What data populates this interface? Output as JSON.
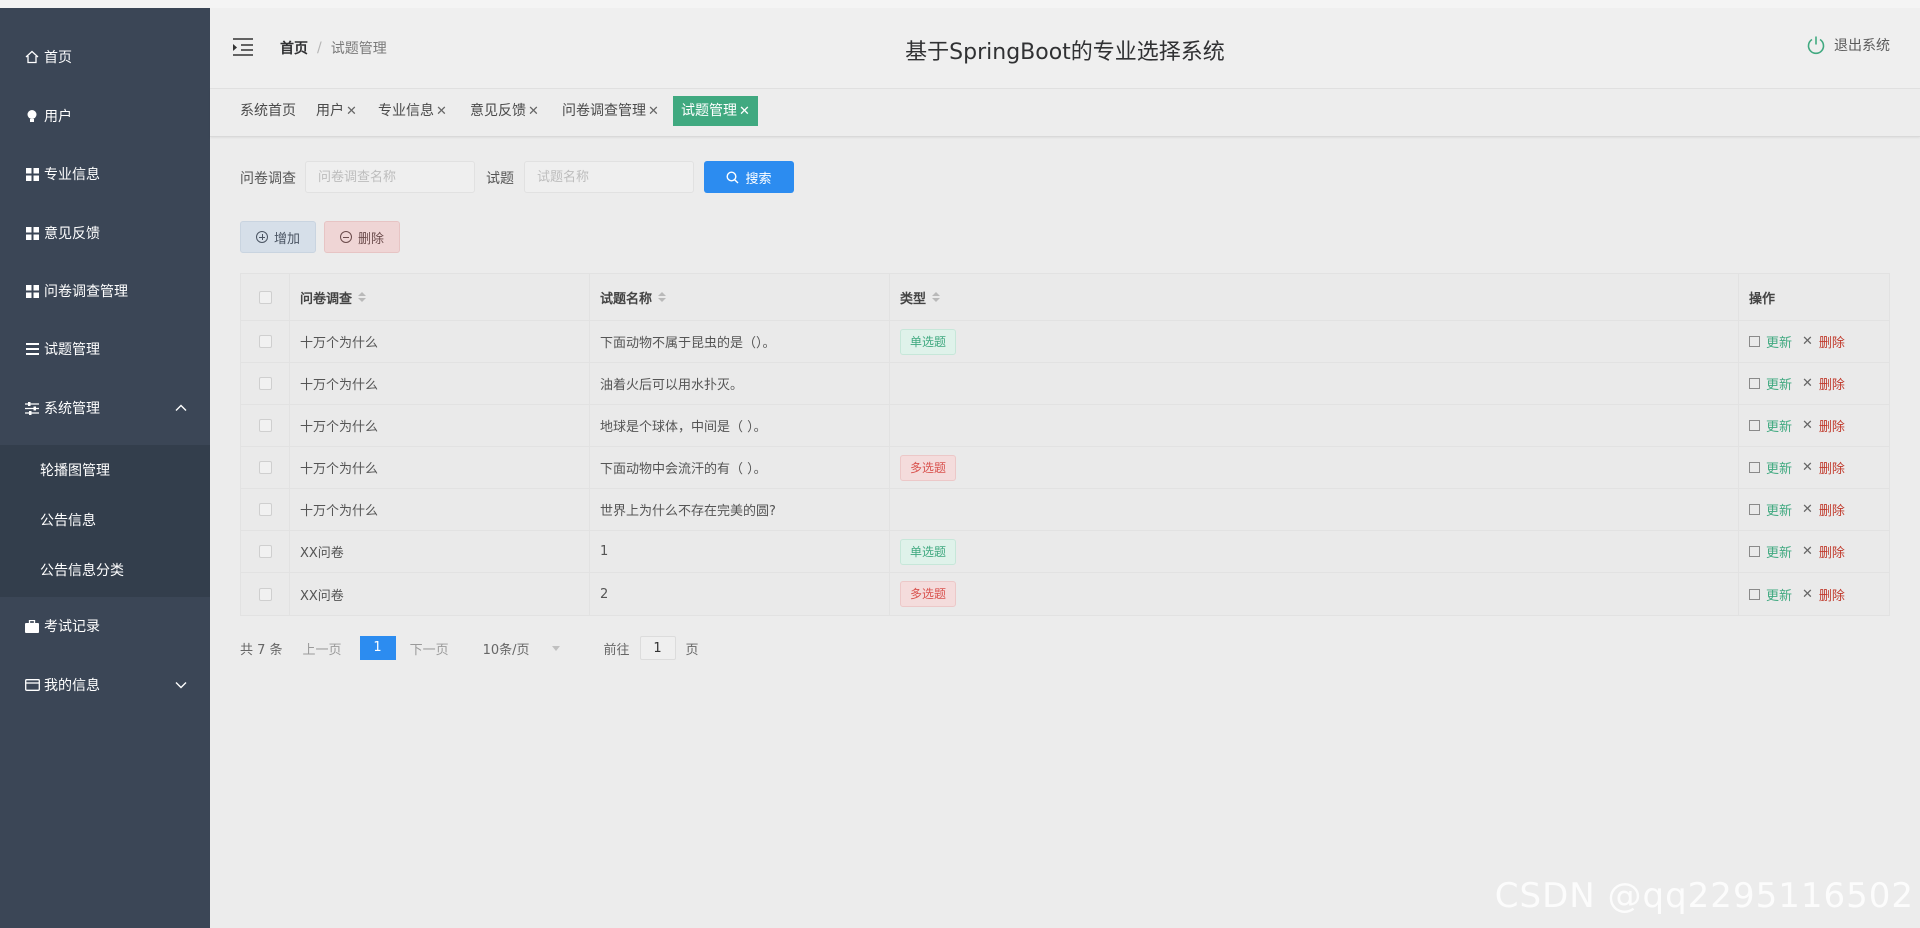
{
  "app_title": "基于SpringBoot的专业选择系统",
  "sidebar": {
    "items": [
      {
        "label": "首页",
        "icon": "home-icon"
      },
      {
        "label": "用户",
        "icon": "bulb-icon"
      },
      {
        "label": "专业信息",
        "icon": "grid-icon"
      },
      {
        "label": "意见反馈",
        "icon": "grid-icon"
      },
      {
        "label": "问卷调查管理",
        "icon": "grid-icon"
      },
      {
        "label": "试题管理",
        "icon": "list-icon"
      },
      {
        "label": "系统管理",
        "icon": "sliders-icon",
        "expanded": true
      },
      {
        "label": "考试记录",
        "icon": "briefcase-icon"
      },
      {
        "label": "我的信息",
        "icon": "card-icon",
        "expanded": false
      }
    ],
    "submenu": [
      "轮播图管理",
      "公告信息",
      "公告信息分类"
    ]
  },
  "header": {
    "breadcrumb_home": "首页",
    "breadcrumb_sep": "/",
    "breadcrumb_current": "试题管理",
    "logout": "退出系统"
  },
  "tabs": [
    {
      "label": "系统首页",
      "closable": false,
      "active": false
    },
    {
      "label": "用户",
      "closable": true,
      "active": false
    },
    {
      "label": "专业信息",
      "closable": true,
      "active": false
    },
    {
      "label": "意见反馈",
      "closable": true,
      "active": false
    },
    {
      "label": "问卷调查管理",
      "closable": true,
      "active": false
    },
    {
      "label": "试题管理",
      "closable": true,
      "active": true
    }
  ],
  "search": {
    "survey_label": "问卷调查",
    "survey_placeholder": "问卷调查名称",
    "question_label": "试题",
    "question_placeholder": "试题名称",
    "button": "搜索"
  },
  "actions": {
    "add": "增加",
    "delete": "删除"
  },
  "table": {
    "columns": [
      "问卷调查",
      "试题名称",
      "类型",
      "操作"
    ],
    "rows": [
      {
        "survey": "十万个为什么",
        "name": "下面动物不属于昆虫的是（）。",
        "type": "单选题"
      },
      {
        "survey": "十万个为什么",
        "name": "油着火后可以用水扑灭。",
        "type": ""
      },
      {
        "survey": "十万个为什么",
        "name": "地球是个球体，中间是（ ）。",
        "type": ""
      },
      {
        "survey": "十万个为什么",
        "name": "下面动物中会流汗的有（ ）。",
        "type": "多选题"
      },
      {
        "survey": "十万个为什么",
        "name": "世界上为什么不存在完美的圆?",
        "type": ""
      },
      {
        "survey": "XX问卷",
        "name": "1",
        "type": "单选题"
      },
      {
        "survey": "XX问卷",
        "name": "2",
        "type": "多选题"
      }
    ],
    "op_edit": "更新",
    "op_delete": "删除"
  },
  "pagination": {
    "total": "共 7 条",
    "prev": "上一页",
    "current": "1",
    "next": "下一页",
    "page_size": "10条/页",
    "goto_prefix": "前往",
    "goto_value": "1",
    "goto_suffix": "页"
  },
  "watermark": "CSDN @qq2295116502",
  "colors": {
    "sidebar": "#3b4656",
    "accent_green": "#40a980",
    "primary_blue": "#2c8cf0",
    "danger_red": "#d9534f"
  }
}
